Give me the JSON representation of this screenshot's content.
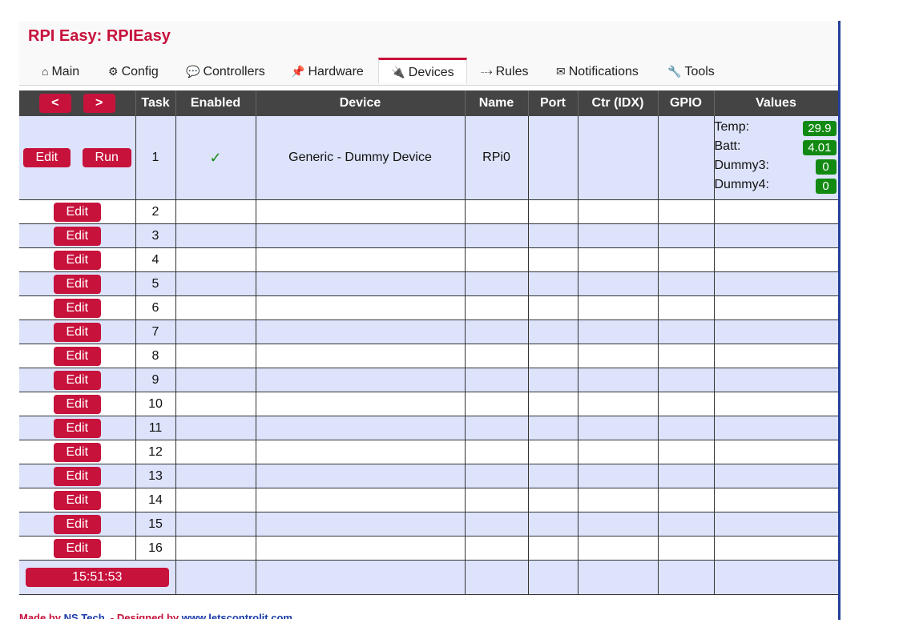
{
  "app_title": "RPI Easy: RPIEasy",
  "tabs": [
    {
      "icon": "⌂",
      "label": "Main"
    },
    {
      "icon": "⚙",
      "label": "Config"
    },
    {
      "icon": "💬",
      "label": "Controllers"
    },
    {
      "icon": "📌",
      "label": "Hardware"
    },
    {
      "icon": "🔌",
      "label": "Devices"
    },
    {
      "icon": "⤏",
      "label": "Rules"
    },
    {
      "icon": "✉",
      "label": "Notifications"
    },
    {
      "icon": "🔧",
      "label": "Tools"
    }
  ],
  "active_tab": "Devices",
  "table": {
    "nav_prev": "<",
    "nav_next": ">",
    "headers": {
      "task": "Task",
      "enabled": "Enabled",
      "device": "Device",
      "name": "Name",
      "port": "Port",
      "ctr": "Ctr (IDX)",
      "gpio": "GPIO",
      "values": "Values"
    },
    "edit_label": "Edit",
    "run_label": "Run",
    "first_row": {
      "task": "1",
      "enabled": "✓",
      "device": "Generic - Dummy Device",
      "name": "RPi0",
      "values": [
        {
          "label": "Temp:",
          "value": "29.9"
        },
        {
          "label": "Batt:",
          "value": "4.01"
        },
        {
          "label": "Dummy3:",
          "value": "0"
        },
        {
          "label": "Dummy4:",
          "value": "0"
        }
      ]
    },
    "task_numbers": [
      "2",
      "3",
      "4",
      "5",
      "6",
      "7",
      "8",
      "9",
      "10",
      "11",
      "12",
      "13",
      "14",
      "15",
      "16"
    ],
    "clock": "15:51:53"
  },
  "footer": {
    "prefix": "Made by ",
    "author": "NS Tech",
    "middle": ". - Designed by ",
    "link": "www.letscontrolit.com"
  },
  "colors": {
    "accent": "#c7123c",
    "header_bg": "#444444",
    "row_alt": "#dde3fb",
    "badge": "#128a12",
    "link": "#1a3ba8"
  }
}
